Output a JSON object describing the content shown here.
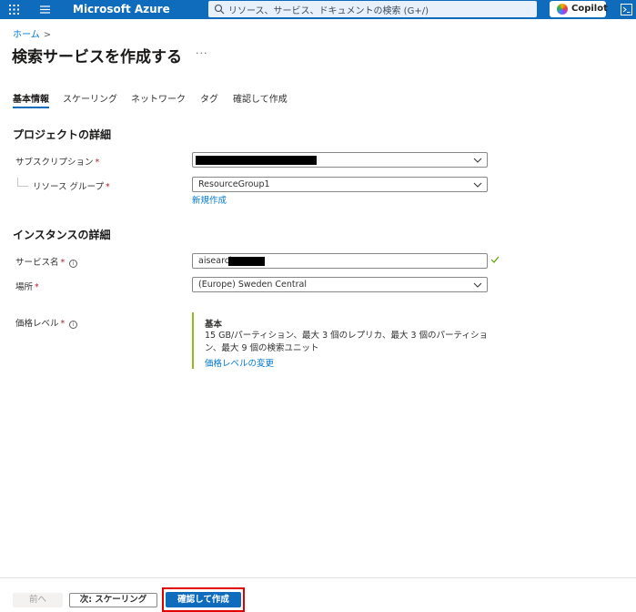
{
  "topbar": {
    "brand": "Microsoft Azure",
    "search_placeholder": "リソース、サービス、ドキュメントの検索 (G+/)",
    "copilot_label": "Copilot"
  },
  "breadcrumb": {
    "home": "ホーム",
    "separator": ">"
  },
  "page": {
    "title": "検索サービスを作成する",
    "more": "···"
  },
  "tabs": [
    "基本情報",
    "スケーリング",
    "ネットワーク",
    "タグ",
    "確認して作成"
  ],
  "sections": {
    "project": "プロジェクトの詳細",
    "instance": "インスタンスの詳細"
  },
  "fields": {
    "subscription_label": "サブスクリプション",
    "resource_group_label": "リソース グループ",
    "resource_group_value": "ResourceGroup1",
    "new_link": "新規作成",
    "service_name_label": "サービス名",
    "service_name_value": "aisearch",
    "location_label": "場所",
    "location_value": "(Europe) Sweden Central",
    "pricing_label": "価格レベル",
    "required_mark": "*",
    "info_mark": "i"
  },
  "pricing": {
    "tier_name": "基本",
    "description": "15 GB/パーティション、最大 3 個のレプリカ、最大 3 個のパーティション、最大 9 個の検索ユニット",
    "change_link": "価格レベルの変更"
  },
  "footer": {
    "prev": "前へ",
    "next": "次: スケーリング",
    "review": "確認して作成"
  },
  "colors": {
    "brand_blue": "#0f6cbd",
    "link_blue": "#0078d4",
    "tier_accent": "#8cbd18",
    "highlight_red": "#e00000",
    "success_green": "#57a300"
  }
}
